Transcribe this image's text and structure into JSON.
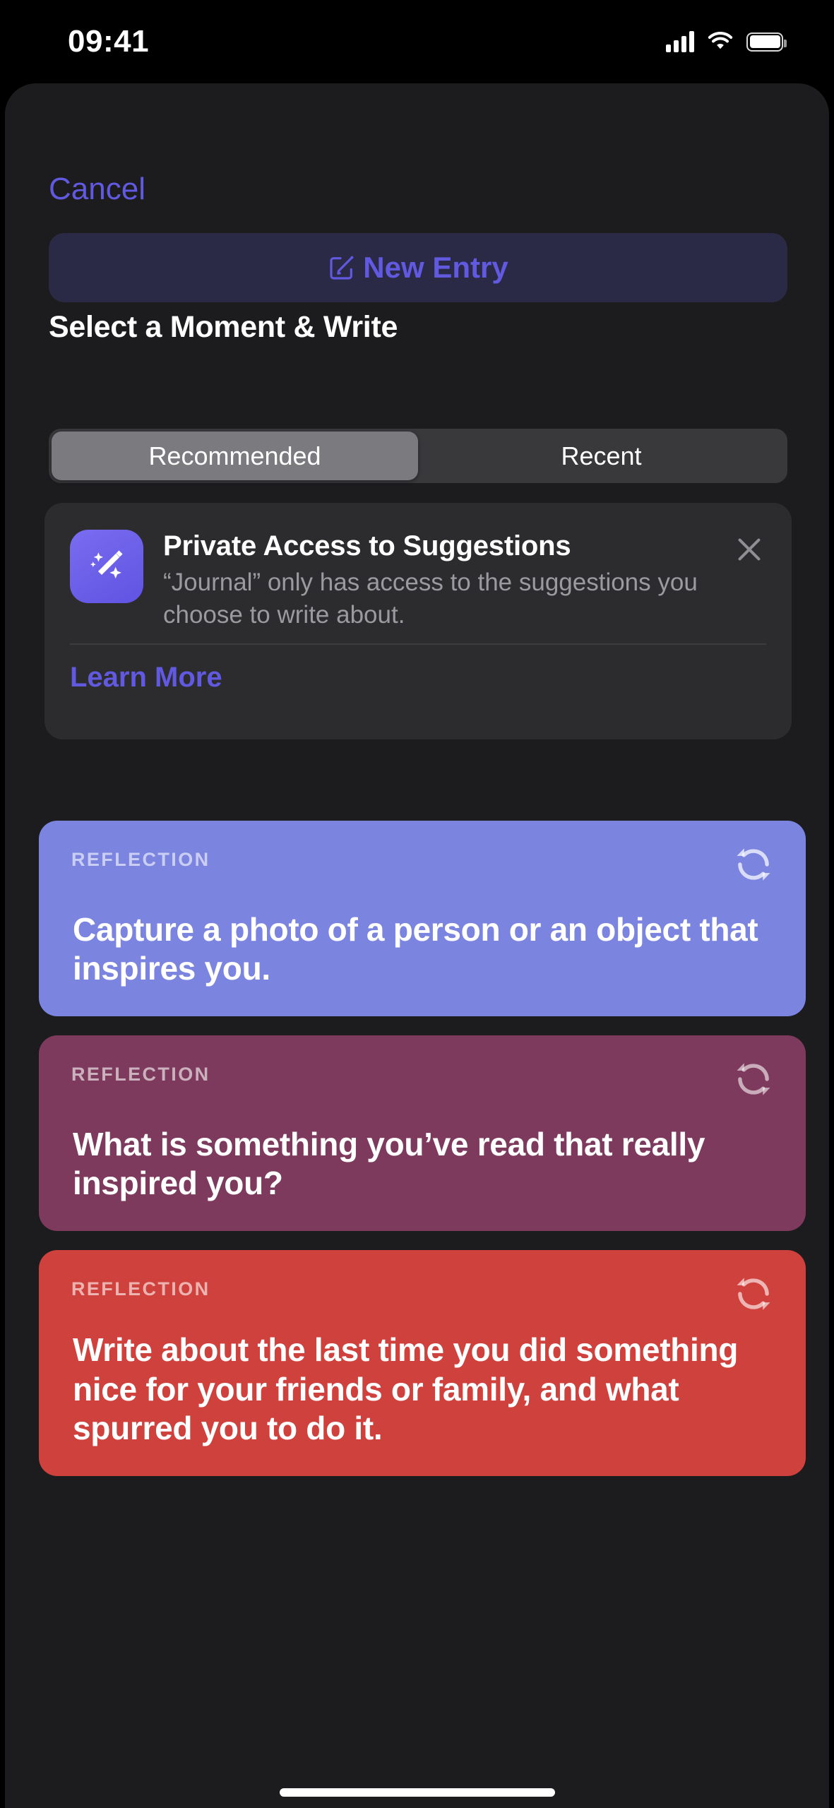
{
  "status_bar": {
    "time": "09:41",
    "cellular_icon": "cellular-signal-icon",
    "wifi_icon": "wifi-icon",
    "battery_icon": "battery-icon"
  },
  "nav": {
    "cancel_label": "Cancel"
  },
  "new_entry": {
    "label": "New Entry",
    "icon": "compose-square-pencil-icon"
  },
  "section": {
    "title": "Select a Moment & Write"
  },
  "segmented": {
    "selected": "Recommended",
    "options": [
      {
        "label": "Recommended",
        "active": true
      },
      {
        "label": "Recent",
        "active": false
      }
    ]
  },
  "privacy_card": {
    "icon": "magic-wand-sparkles-icon",
    "title": "Private Access to Suggestions",
    "body": "“Journal” only has access to the suggestions you choose to write about.",
    "learn_more_label": "Learn More",
    "close_icon": "close-x-icon"
  },
  "suggestion_cards": [
    {
      "kicker": "REFLECTION",
      "prompt": "Capture a photo of a person or an object that inspires you.",
      "color": "#7b85e0",
      "refresh_icon": "refresh-circular-arrows-icon"
    },
    {
      "kicker": "REFLECTION",
      "prompt": "What is something you’ve read that really inspired you?",
      "color": "#7d3a5c",
      "refresh_icon": "refresh-circular-arrows-icon"
    },
    {
      "kicker": "REFLECTION",
      "prompt": "Write about the last time you did something nice for your friends or family, and what spurred you to do it.",
      "color": "#cf413c",
      "refresh_icon": "refresh-circular-arrows-icon"
    }
  ],
  "colors": {
    "accent": "#6159e0",
    "sheet_background": "#1c1c1e",
    "card_background": "#2c2c2e"
  }
}
